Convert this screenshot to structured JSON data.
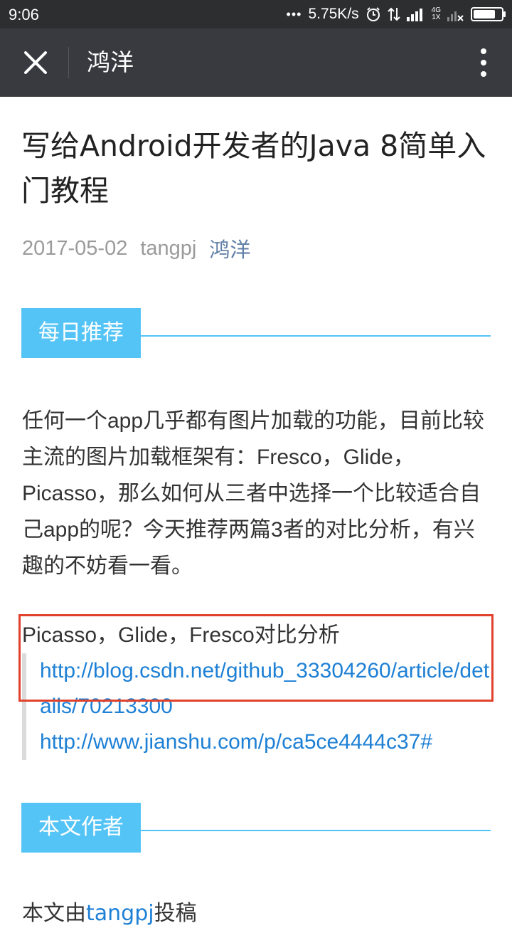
{
  "status_bar": {
    "time": "9:06",
    "dots": "•••",
    "speed": "5.75K/s",
    "net_top": "4G",
    "net_bottom": "1X",
    "icons": [
      "alarm-icon",
      "data-transfer-icon",
      "signal-icon",
      "signal-off-icon",
      "battery-icon"
    ]
  },
  "header": {
    "title": "鸿洋",
    "icons": [
      "close-icon",
      "more-vertical-icon"
    ]
  },
  "article": {
    "title": "写给Android开发者的Java 8简单入门教程",
    "date": "2017-05-02",
    "author": "tangpj",
    "account": "鸿洋"
  },
  "section1": {
    "label": "每日推荐"
  },
  "paragraph": "任何一个app几乎都有图片加载的功能，目前比较主流的图片加载框架有：Fresco，Glide，Picasso，那么如何从三者中选择一个比较适合自己app的呢？今天推荐两篇3者的对比分析，有兴趣的不妨看一看。",
  "links": {
    "title": "Picasso，Glide，Fresco对比分析",
    "items": [
      "http://blog.csdn.net/github_33304260/article/details/70213300",
      "http://www.jianshu.com/p/ca5ce4444c37#"
    ]
  },
  "section2": {
    "label": "本文作者"
  },
  "cut_text": {
    "prefix": "本文由",
    "link": "tangpj",
    "suffix": "投稿"
  },
  "colors": {
    "header_bg": "#393a3f",
    "status_bg": "#2d2e30",
    "accent": "#54c4f6",
    "link": "#1e80d5",
    "highlight_box": "#e0412c"
  }
}
